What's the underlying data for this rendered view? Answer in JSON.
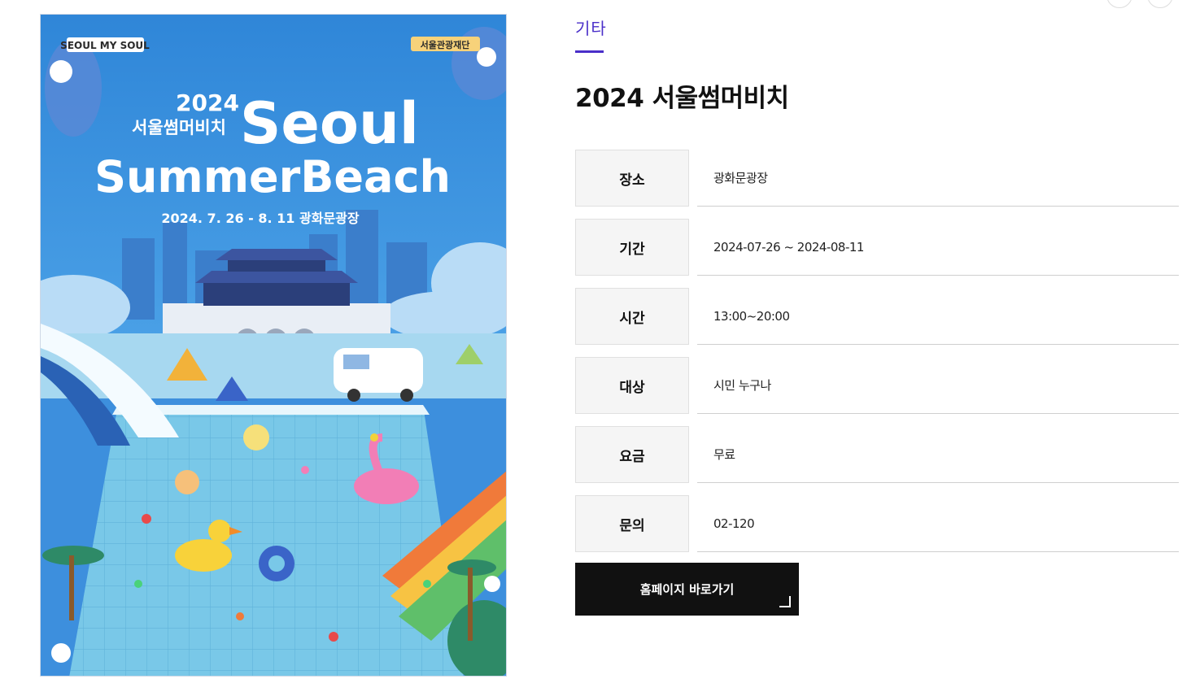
{
  "poster": {
    "logo_left": "SEOUL MY SOUL",
    "logo_right": "서울관광재단",
    "year": "2024",
    "korean_title": "서울썸머비치",
    "title_line1": "Seoul",
    "title_line2": "SummerBeach",
    "dates_place": "2024. 7. 26 - 8. 11  광화문광장"
  },
  "category": "기타",
  "title": "2024 서울썸머비치",
  "info": [
    {
      "label": "장소",
      "value": "광화문광장"
    },
    {
      "label": "기간",
      "value": "2024-07-26 ~ 2024-08-11"
    },
    {
      "label": "시간",
      "value": "13:00~20:00"
    },
    {
      "label": "대상",
      "value": "시민 누구나"
    },
    {
      "label": "요금",
      "value": "무료"
    },
    {
      "label": "문의",
      "value": "02-120"
    }
  ],
  "homepage_button": "홈페이지 바로가기",
  "colors": {
    "accent": "#4a2fc9",
    "button_bg": "#111111",
    "poster_sky": "#3d8fdd",
    "poster_pool": "#6ec3e6"
  }
}
